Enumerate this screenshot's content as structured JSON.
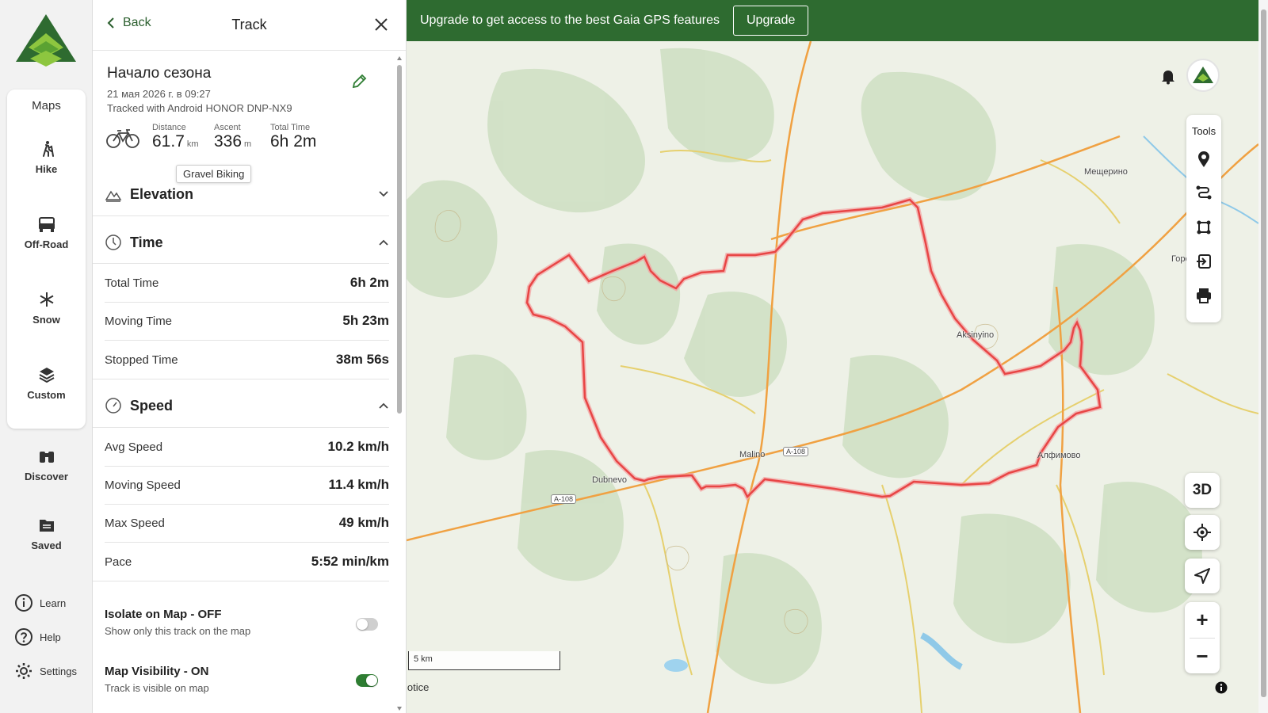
{
  "nav": {
    "maps_title": "Maps",
    "items": [
      {
        "label": "Hike",
        "icon": "hiker-icon"
      },
      {
        "label": "Off-Road",
        "icon": "jeep-icon"
      },
      {
        "label": "Snow",
        "icon": "snowflake-icon"
      },
      {
        "label": "Custom",
        "icon": "layers-icon"
      },
      {
        "label": "Discover",
        "icon": "binoculars-icon"
      },
      {
        "label": "Saved",
        "icon": "folder-icon"
      }
    ],
    "learn": "Learn",
    "help": "Help",
    "settings": "Settings"
  },
  "panel": {
    "back_label": "Back",
    "title": "Track",
    "track_name": "Начало сезона",
    "date": "21 мая 2026 г. в 09:27",
    "device": "Tracked with Android HONOR DNP-NX9",
    "activity_tooltip": "Gravel Biking",
    "stats": {
      "distance_label": "Distance",
      "distance_value": "61.7",
      "distance_unit": "km",
      "ascent_label": "Ascent",
      "ascent_value": "336",
      "ascent_unit": "m",
      "total_time_label": "Total Time",
      "total_time_value": "6h 2m"
    },
    "elevation": {
      "title": "Elevation"
    },
    "time": {
      "title": "Time",
      "rows": [
        {
          "label": "Total Time",
          "value": "6h 2m"
        },
        {
          "label": "Moving Time",
          "value": "5h 23m"
        },
        {
          "label": "Stopped Time",
          "value": "38m 56s"
        }
      ]
    },
    "speed": {
      "title": "Speed",
      "rows": [
        {
          "label": "Avg Speed",
          "value": "10.2 km/h"
        },
        {
          "label": "Moving Speed",
          "value": "11.4 km/h"
        },
        {
          "label": "Max Speed",
          "value": "49 km/h"
        },
        {
          "label": "Pace",
          "value": "5:52 min/km"
        }
      ]
    },
    "isolate": {
      "title": "Isolate on Map - OFF",
      "subtitle": "Show only this track on the map",
      "on": false
    },
    "visibility": {
      "title": "Map Visibility - ON",
      "subtitle": "Track is visible on map",
      "on": true
    }
  },
  "banner": {
    "text": "Upgrade to get access to the best Gaia GPS features",
    "button": "Upgrade"
  },
  "map": {
    "tools_label": "Tools",
    "btn_3d": "3D",
    "zoom_in": "+",
    "zoom_out": "−",
    "scale_label": "5 km",
    "notice": "lotice",
    "places": [
      "Мещерино",
      "Горо",
      "Aksinyino",
      "Malino",
      "Dubnevo",
      "Алфимово"
    ],
    "road_shield": "A-108",
    "colors": {
      "track": "#ee4444",
      "forest": "#cfe0c4",
      "road_major": "#f0a142",
      "road_minor": "#e8d36a",
      "banner": "#2e6b30"
    }
  }
}
